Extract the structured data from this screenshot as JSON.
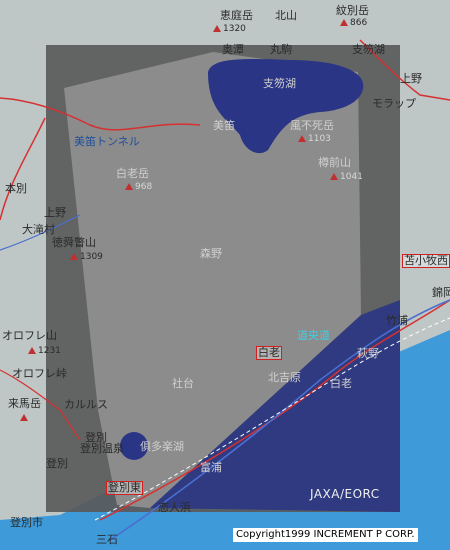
{
  "map": {
    "title_labels": {
      "erimo_dake": "恵庭岳",
      "erimo_dake_elev": "1320",
      "monbetsu_dake": "紋別岳",
      "monbetsu_dake_elev": "866",
      "tarumae_san": "樽前山",
      "tarumae_san_elev": "1041",
      "fuppushi_dake": "風不死岳",
      "fuppushi_dake_elev": "1103",
      "shirao_dake": "白老岳",
      "shirao_dake_elev": "968",
      "tokushun_be": "徳舜瞥山",
      "tokushun_be_elev": "1309",
      "orofure_yama": "オロフレ山",
      "orofure_yama_elev": "1231",
      "kurumatsu_dake": "来馬岳",
      "noboribetsu_onsen": "登別温泉",
      "noboribetsu": "登別",
      "noboribetsu_city": "登別市",
      "noboribetsu_higashi": "登別東",
      "tomakomai_nishi": "苫小牧西",
      "shiraoi_ic": "白老",
      "doo_expressway": "道央道",
      "bifue_tunnel": "美笛トンネル",
      "orofure_pass": "オロフレ峠",
      "karurusu": "カルルス",
      "kusuri_lake": "俱多楽湖",
      "shikotsu_lake": "支笏湖",
      "morappu": "モラップ",
      "marukoma": "丸駒",
      "okotan": "奥潭",
      "shikotsu_shi": "支笏湖",
      "hokkai": "北山",
      "ohtaki": "大滝村",
      "honbetsu": "本別",
      "kamino": "上野",
      "bifu": "美笛",
      "nishiki": "錦岡",
      "takeura": "竹浦",
      "shiraoi_town": "白老",
      "hagino": "萩野",
      "shadai": "社台",
      "mori_nojiri": "森野",
      "kitayoshihara": "北吉原",
      "noboribetsu_east_label": "登別東",
      "koibiru": "恋人浜",
      "mitsuishi": "三石",
      "fuura": "富浦",
      "jaxa": "JAXA/EORC",
      "copyright": "Copyright1999 INCREMENT P CORP."
    },
    "colors": {
      "land": "#bfc6c6",
      "sea": "#3e9ad8",
      "sar_overlay": "#5a5a5a",
      "lake": "#2b3585",
      "road_red": "#d63030",
      "road_blue": "#4a6fd0"
    }
  }
}
